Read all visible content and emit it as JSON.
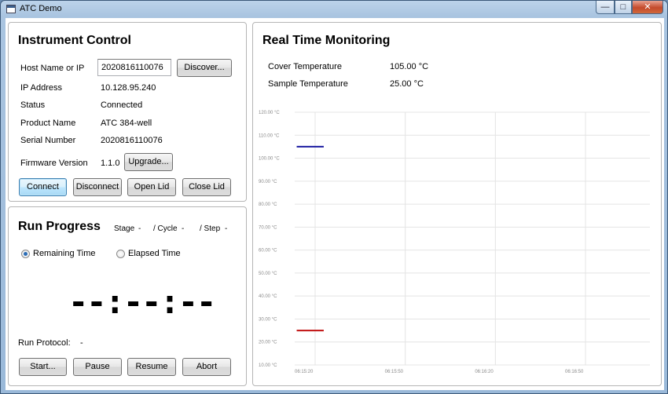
{
  "window": {
    "title": "ATC Demo",
    "minimize_symbol": "—",
    "maximize_symbol": "□",
    "close_symbol": "✕"
  },
  "instrument_control": {
    "title": "Instrument Control",
    "host_label": "Host Name or IP",
    "host_value": "2020816110076",
    "discover_label": "Discover...",
    "ip_label": "IP Address",
    "ip_value": "10.128.95.240",
    "status_label": "Status",
    "status_value": "Connected",
    "product_label": "Product Name",
    "product_value": "ATC 384-well",
    "serial_label": "Serial Number",
    "serial_value": "2020816110076",
    "firmware_label": "Firmware Version",
    "firmware_value": "1.1.0",
    "upgrade_label": "Upgrade...",
    "connect_label": "Connect",
    "disconnect_label": "Disconnect",
    "open_lid_label": "Open Lid",
    "close_lid_label": "Close Lid"
  },
  "run_progress": {
    "title": "Run Progress",
    "stage_label": "Stage",
    "stage_value": "-",
    "cycle_label": "/ Cycle",
    "cycle_value": "-",
    "step_label": "/ Step",
    "step_value": "-",
    "remaining_label": "Remaining Time",
    "elapsed_label": "Elapsed Time",
    "selected_mode": "Remaining Time",
    "time_display": "--:--:--",
    "protocol_label": "Run Protocol:",
    "protocol_value": "-",
    "start_label": "Start...",
    "pause_label": "Pause",
    "resume_label": "Resume",
    "abort_label": "Abort"
  },
  "monitoring": {
    "title": "Real Time Monitoring",
    "cover_label": "Cover Temperature",
    "cover_value": "105.00 °C",
    "sample_label": "Sample Temperature",
    "sample_value": "25.00 °C"
  },
  "chart_data": {
    "type": "line",
    "y_ticks": [
      "120.00 °C",
      "110.00 °C",
      "100.00 °C",
      "90.00 °C",
      "80.00 °C",
      "70.00 °C",
      "60.00 °C",
      "50.00 °C",
      "40.00 °C",
      "30.00 °C",
      "20.00 °C",
      "10.00 °C"
    ],
    "x_ticks": [
      "06:15:20",
      "06:15:50",
      "06:16:20",
      "06:16:50"
    ],
    "ylim": [
      10,
      120
    ],
    "x_seconds": [
      0,
      30,
      60,
      90
    ],
    "grid": true,
    "colors": {
      "cover": "#1a1aa0",
      "sample": "#c01010",
      "grid": "#e4e4e4"
    },
    "series": [
      {
        "x": [
          -3,
          6
        ],
        "values": [
          105,
          105
        ]
      },
      {
        "x": [
          -3,
          6
        ],
        "values": [
          25,
          25
        ]
      }
    ]
  }
}
